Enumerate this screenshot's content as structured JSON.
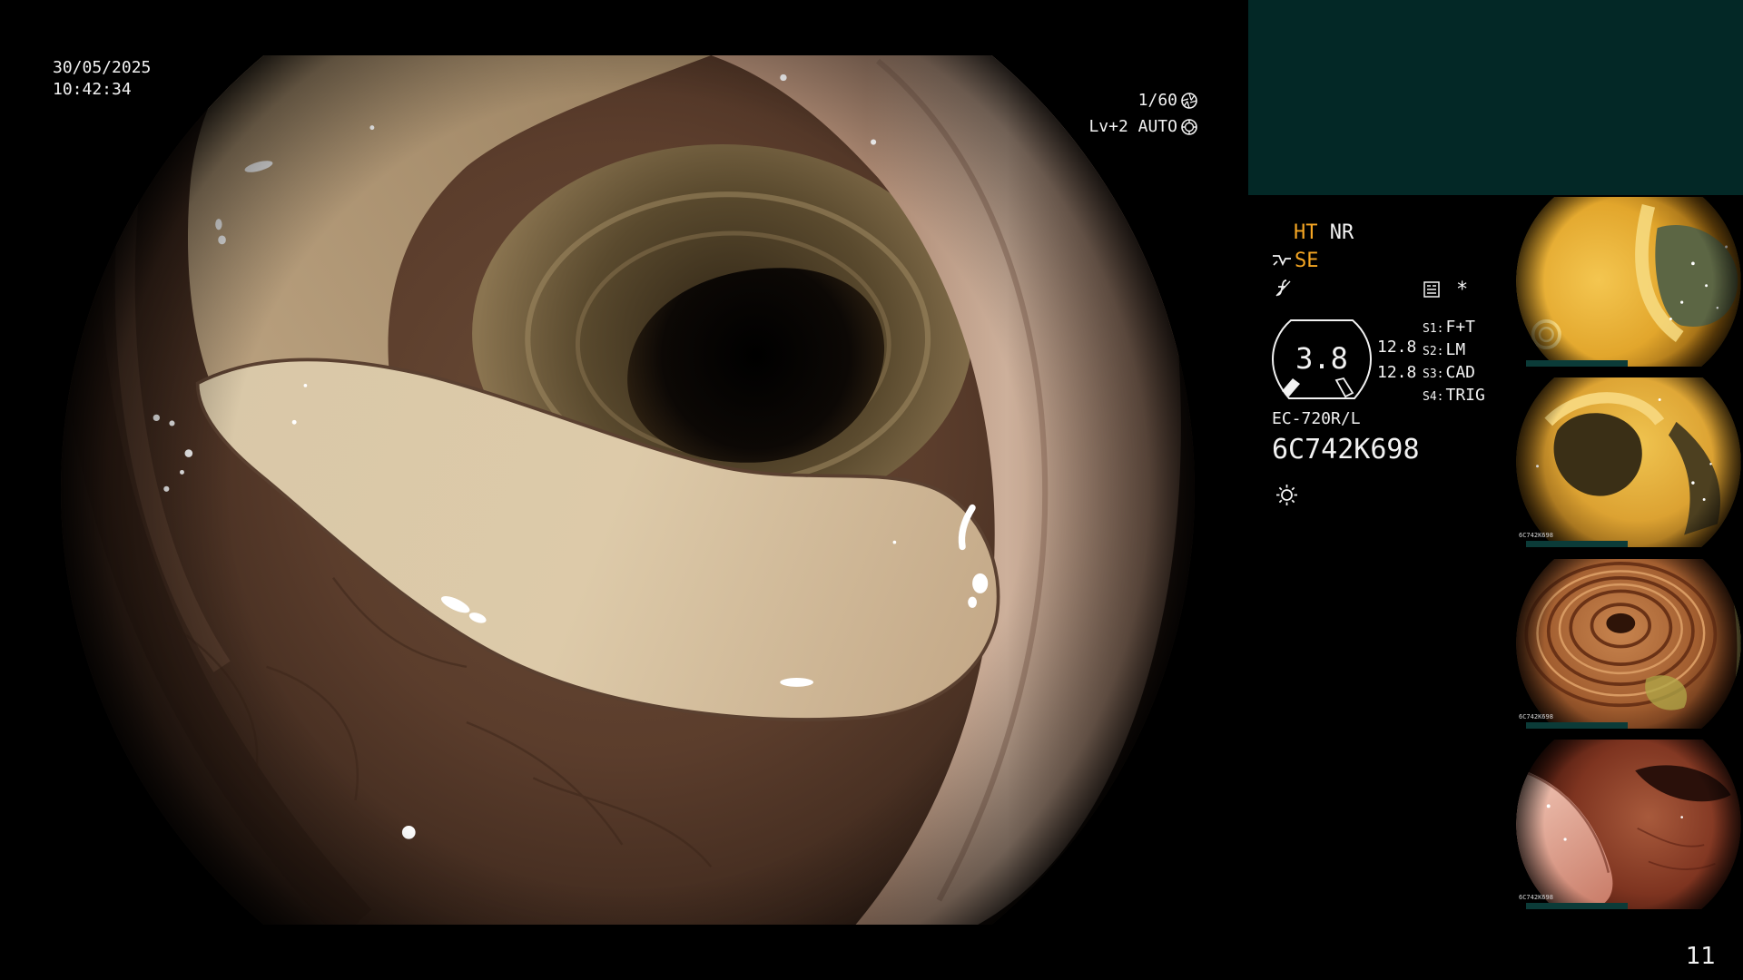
{
  "overlay": {
    "date": "30/05/2025",
    "time": "10:42:34",
    "shutter_speed": "1/60",
    "shutter_icon": "shutter-icon",
    "light_level": "Lv+2 AUTO",
    "iris_icon": "iris-icon"
  },
  "settings_panel": {
    "ht_label": "HT",
    "nr_label": "NR",
    "se_icon": "curve-arrow-icon",
    "se_label": "SE",
    "structure_icon": "f-slash-icon",
    "memo_icon": "document-icon",
    "asterisk": "*",
    "zoom_value": "3.8",
    "gauge_left_mark_icon": "filled-marker-icon",
    "gauge_right_mark_icon": "outline-marker-icon",
    "value_top": "12.8",
    "value_bottom": "12.8",
    "switches": [
      {
        "key": "S1:",
        "value": "F+T"
      },
      {
        "key": "S2:",
        "value": "LM"
      },
      {
        "key": "S3:",
        "value": "CAD"
      },
      {
        "key": "S4:",
        "value": "TRIG"
      }
    ],
    "scope_model": "EC-720R/L",
    "scope_serial": "6C742K698",
    "light_icon": "sun-icon"
  },
  "thumbnails": [
    {},
    {
      "serial": "6C742K698"
    },
    {
      "serial": "6C742K698"
    },
    {
      "serial": "6C742K698"
    }
  ],
  "page_number": "11",
  "colors": {
    "background": "#000000",
    "text": "#f2f2f2",
    "highlight": "#f5a623",
    "panel_teal": "#032826",
    "thumbnail_bar": "#0b3b38"
  }
}
